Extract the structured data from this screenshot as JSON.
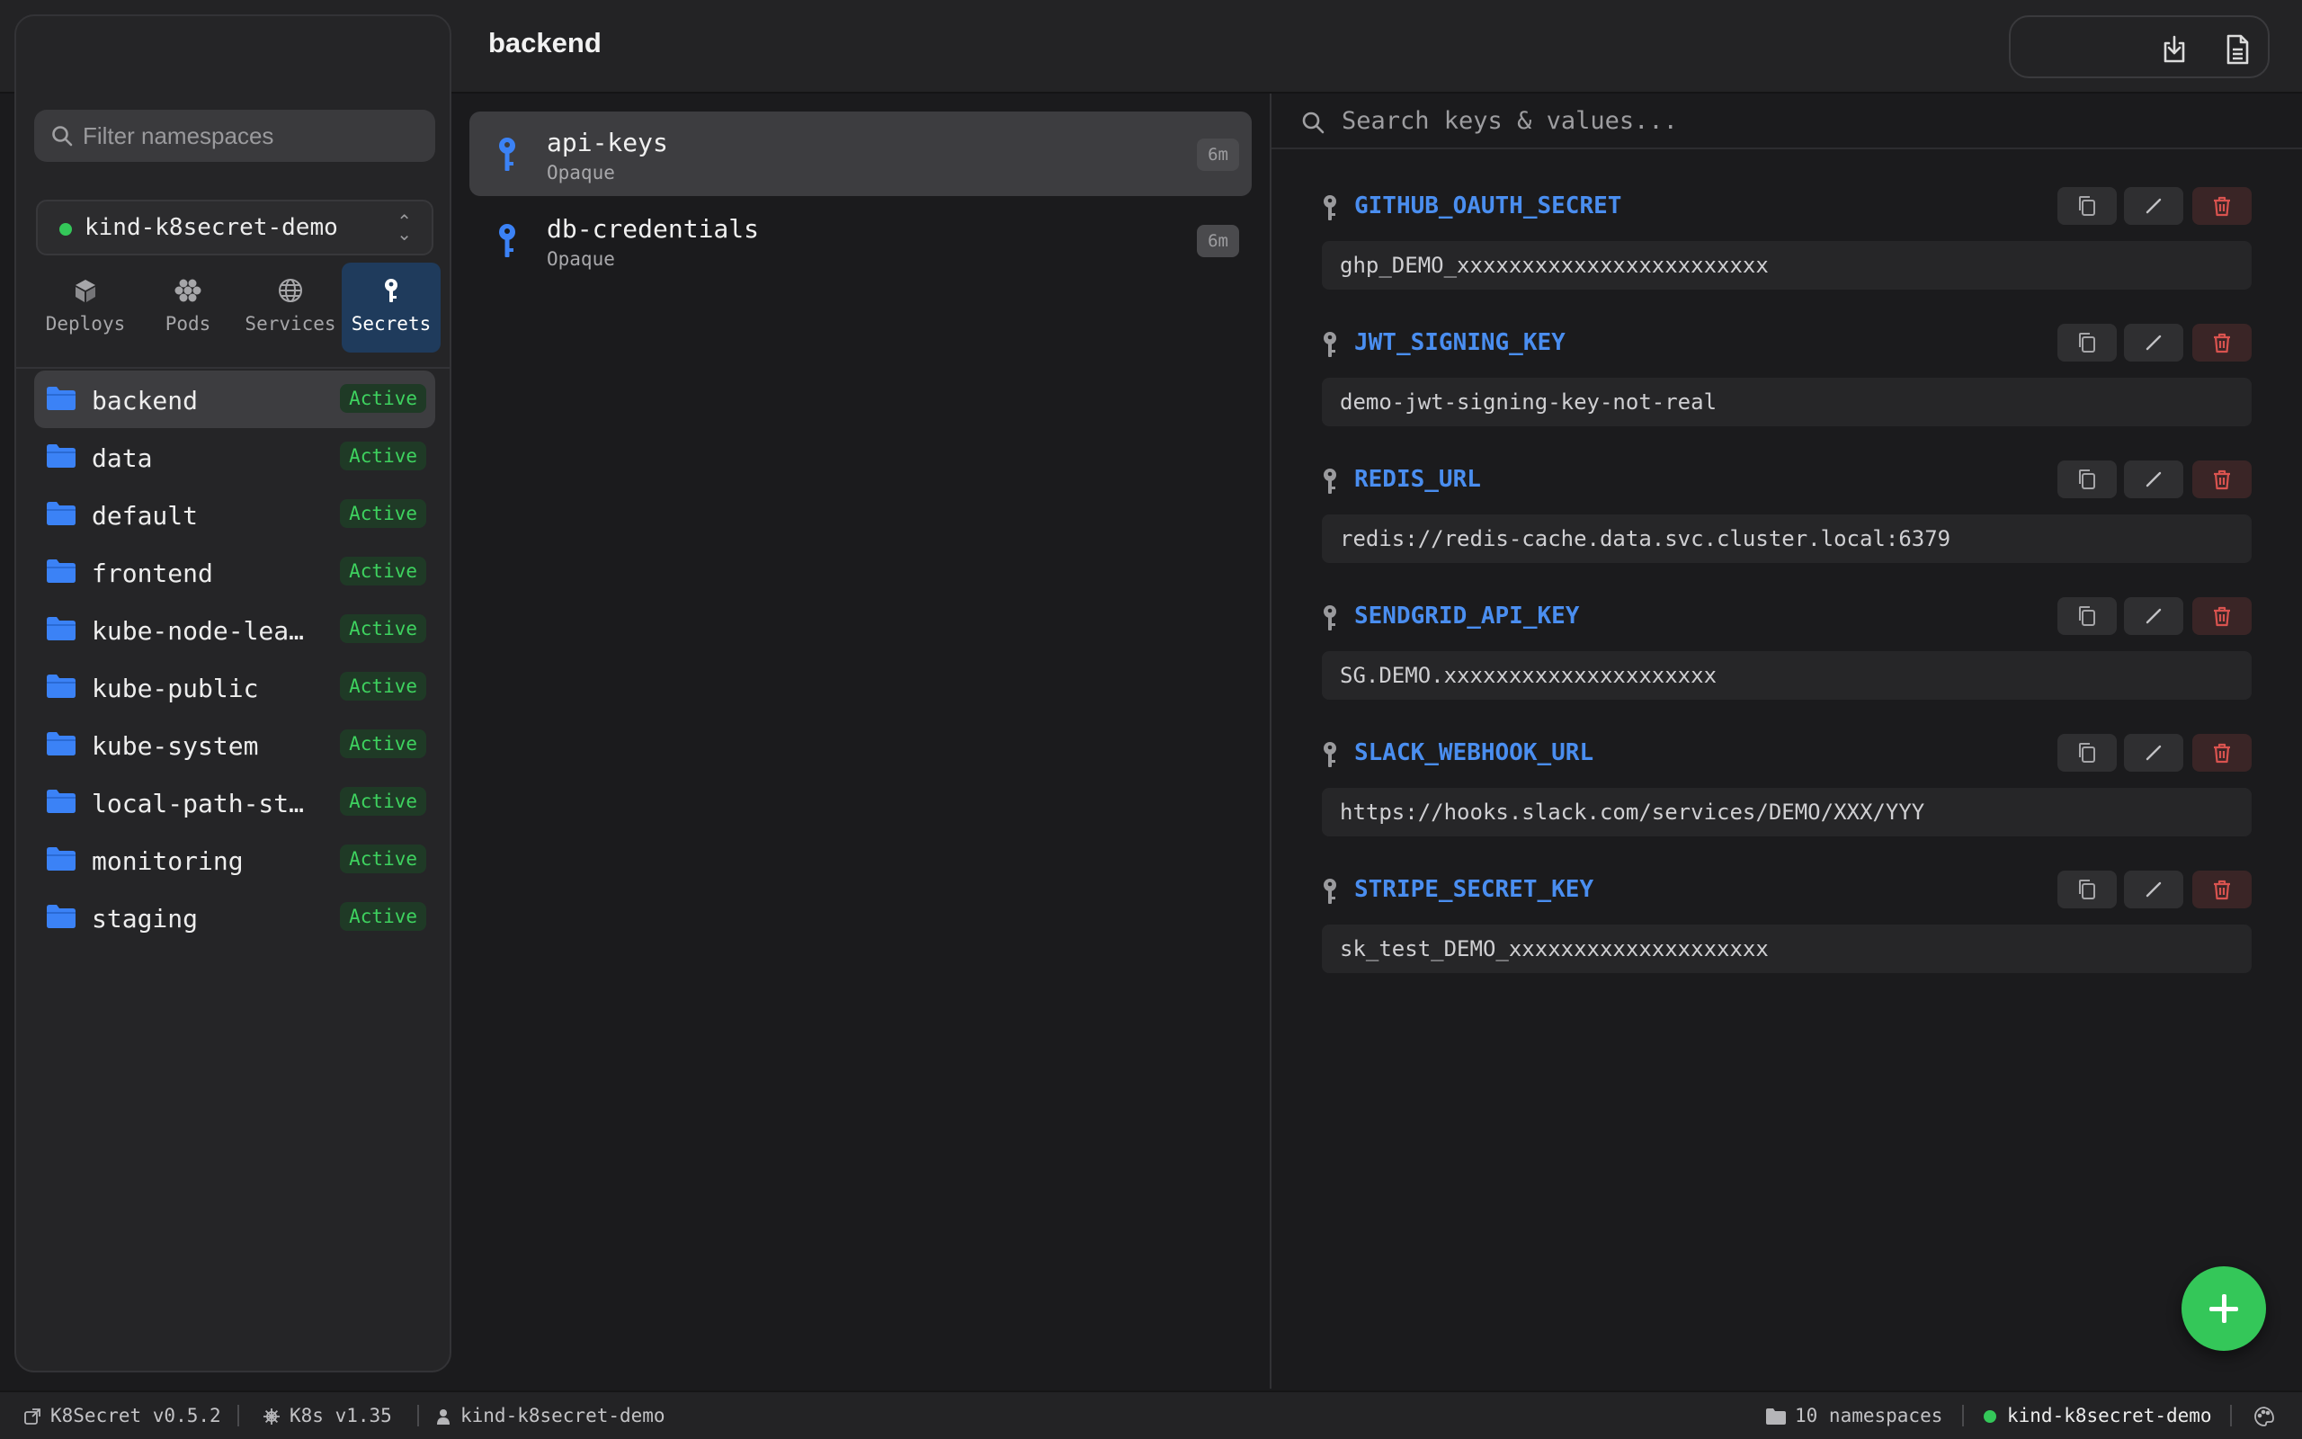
{
  "window": {
    "title": "backend"
  },
  "sidebar": {
    "search_placeholder": "Filter namespaces",
    "cluster": "kind-k8secret-demo",
    "tabs": [
      {
        "label": "Deploys",
        "icon": "cube-icon"
      },
      {
        "label": "Pods",
        "icon": "hexagons-icon"
      },
      {
        "label": "Services",
        "icon": "globe-icon"
      },
      {
        "label": "Secrets",
        "icon": "key-icon",
        "active": true
      }
    ],
    "namespaces": [
      {
        "name": "backend",
        "status": "Active",
        "selected": true
      },
      {
        "name": "data",
        "status": "Active"
      },
      {
        "name": "default",
        "status": "Active"
      },
      {
        "name": "frontend",
        "status": "Active"
      },
      {
        "name": "kube-node-lease",
        "status": "Active"
      },
      {
        "name": "kube-public",
        "status": "Active"
      },
      {
        "name": "kube-system",
        "status": "Active"
      },
      {
        "name": "local-path-sto…",
        "status": "Active"
      },
      {
        "name": "monitoring",
        "status": "Active"
      },
      {
        "name": "staging",
        "status": "Active"
      }
    ]
  },
  "secrets": [
    {
      "name": "api-keys",
      "type": "Opaque",
      "age": "6m",
      "selected": true
    },
    {
      "name": "db-credentials",
      "type": "Opaque",
      "age": "6m"
    }
  ],
  "detail": {
    "search_placeholder": "Search keys & values...",
    "entries": [
      {
        "key": "GITHUB_OAUTH_SECRET",
        "value": "ghp_DEMO_xxxxxxxxxxxxxxxxxxxxxxxx"
      },
      {
        "key": "JWT_SIGNING_KEY",
        "value": "demo-jwt-signing-key-not-real"
      },
      {
        "key": "REDIS_URL",
        "value": "redis://redis-cache.data.svc.cluster.local:6379"
      },
      {
        "key": "SENDGRID_API_KEY",
        "value": "SG.DEMO.xxxxxxxxxxxxxxxxxxxxx"
      },
      {
        "key": "SLACK_WEBHOOK_URL",
        "value": "https://hooks.slack.com/services/DEMO/XXX/YYY"
      },
      {
        "key": "STRIPE_SECRET_KEY",
        "value": "sk_test_DEMO_xxxxxxxxxxxxxxxxxxxx"
      }
    ]
  },
  "statusbar": {
    "version": "K8Secret v0.5.2",
    "k8s_version": "K8s v1.35",
    "context": "kind-k8secret-demo",
    "namespaces": "10 namespaces",
    "cluster": "kind-k8secret-demo"
  },
  "colors": {
    "accent_blue": "#4a8ef0",
    "active_green": "#3ed25f",
    "delete_red": "#d9534f",
    "fab_green": "#34c759"
  }
}
